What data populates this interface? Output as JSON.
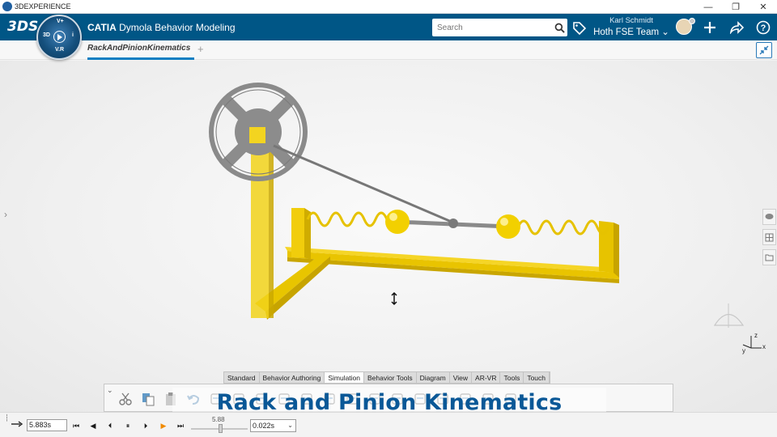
{
  "window": {
    "title": "3DEXPERIENCE",
    "controls": [
      "minimize",
      "restore",
      "close"
    ]
  },
  "header": {
    "brand_prefix": "CATIA",
    "brand_app": "Dymola Behavior Modeling",
    "compass": {
      "top": "V+",
      "left": "3D",
      "right": "i",
      "bottom": "V.R"
    },
    "search_placeholder": "Search",
    "user_name": "Karl Schmidt",
    "team": "Hoth FSE Team",
    "team_chevron": "⌄"
  },
  "tabs": {
    "active_label": "RackAndPinionKinematics",
    "add_label": "+"
  },
  "section_tabs": [
    "Standard",
    "Behavior Authoring",
    "Simulation",
    "Behavior Tools",
    "Diagram",
    "View",
    "AR-VR",
    "Tools",
    "Touch"
  ],
  "active_section": "Simulation",
  "toolbar_icons": [
    "cut-icon",
    "copy-icon",
    "paste-icon",
    "undo-icon",
    "move-icon",
    "clock-icon",
    "calculator-icon",
    "database-icon",
    "tool-icon",
    "list-icon",
    "edit-icon",
    "chart-icon",
    "edit-window-icon",
    "pencil-icon",
    "italic-l-icon",
    "play-run-icon",
    "camera-icon",
    "layout-icon"
  ],
  "overlay": {
    "title": "Rack and Pinion Kinematics"
  },
  "player": {
    "time_value": "5.883s",
    "slider_value": "5.88",
    "step_value": "0.022s",
    "buttons": [
      "⏮",
      "◀",
      "⏴",
      "⏸",
      "⏵",
      "▶",
      "⏭"
    ]
  },
  "scene": {
    "axis_labels": {
      "x": "x",
      "y": "y",
      "z": "z"
    },
    "colors": {
      "yellow": "#f2d000",
      "gray": "#8e8e8e",
      "accent_blue": "#005686",
      "highlight_blue": "#0f7fc2"
    }
  }
}
